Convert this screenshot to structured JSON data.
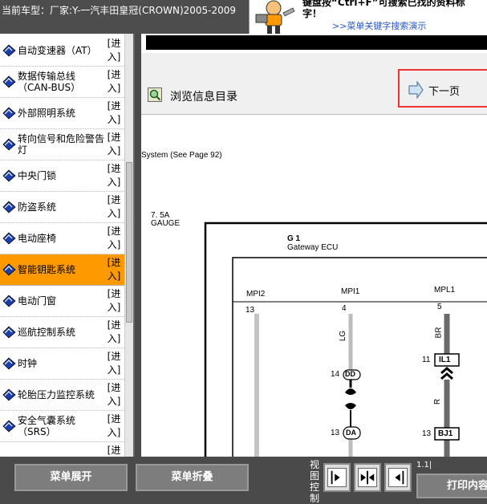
{
  "header": {
    "car_title": "当前车型：厂家:Y-一汽丰田皇冠(CROWN)2005-2009",
    "tip_line1": "键盘按“Ctrl+F”可搜索已找的资料标",
    "tip_line2": "字！",
    "tip_link": ">>菜单关键字搜索演示"
  },
  "sidebar": {
    "items": [
      {
        "label": "自动变速器（AT）",
        "enter": "[进入]"
      },
      {
        "label": "数据传输总线（CAN-BUS）",
        "enter": "[进入]"
      },
      {
        "label": "外部照明系统",
        "enter": "[进入]"
      },
      {
        "label": "转向信号和危险警告灯",
        "enter": "[进入]"
      },
      {
        "label": "中央门锁",
        "enter": "[进入]"
      },
      {
        "label": "防盗系统",
        "enter": "[进入]"
      },
      {
        "label": "电动座椅",
        "enter": "[进入]"
      },
      {
        "label": "智能钥匙系统",
        "enter": "[进入]"
      },
      {
        "label": "电动门窗",
        "enter": "[进入]"
      },
      {
        "label": "巡航控制系统",
        "enter": "[进入]"
      },
      {
        "label": "时钟",
        "enter": "[进入]"
      },
      {
        "label": "轮胎压力监控系统",
        "enter": "[进入]"
      },
      {
        "label": "安全气囊系统（SRS）",
        "enter": "[进入]"
      },
      {
        "label": "",
        "enter": "[进"
      }
    ],
    "active_index": 7
  },
  "toolbar": {
    "browse_label": "浏览信息目录",
    "next_label": "下一页"
  },
  "diagram": {
    "system_ref": "System (See Page 92)",
    "fuse_amp": "7. 5A",
    "fuse_name": "GAUGE",
    "ecu_id": "G 1",
    "ecu_name": "Gateway ECU",
    "pins": [
      {
        "name": "MPI2",
        "num": "13"
      },
      {
        "name": "MPI1",
        "num": "4"
      },
      {
        "name": "MPL1",
        "num": "5"
      }
    ],
    "wire_lg": "LG",
    "wire_br": "BR",
    "wire_r": "R",
    "conn_dd_num": "14",
    "conn_dd": "DD",
    "conn_da_num": "13",
    "conn_da": "DA",
    "conn_il1_num": "11",
    "conn_il1": "IL1",
    "conn_bj1_num": "13",
    "conn_bj1": "BJ1"
  },
  "bottom": {
    "expand_label": "菜单展开",
    "collapse_label": "菜单折叠",
    "view_label": "视图控制",
    "page_indicator": "1.1|",
    "print_label": "打印内容"
  },
  "colors": {
    "active_item": "#ff9900",
    "highlight_border": "#ee3333",
    "link": "#2255cc"
  }
}
